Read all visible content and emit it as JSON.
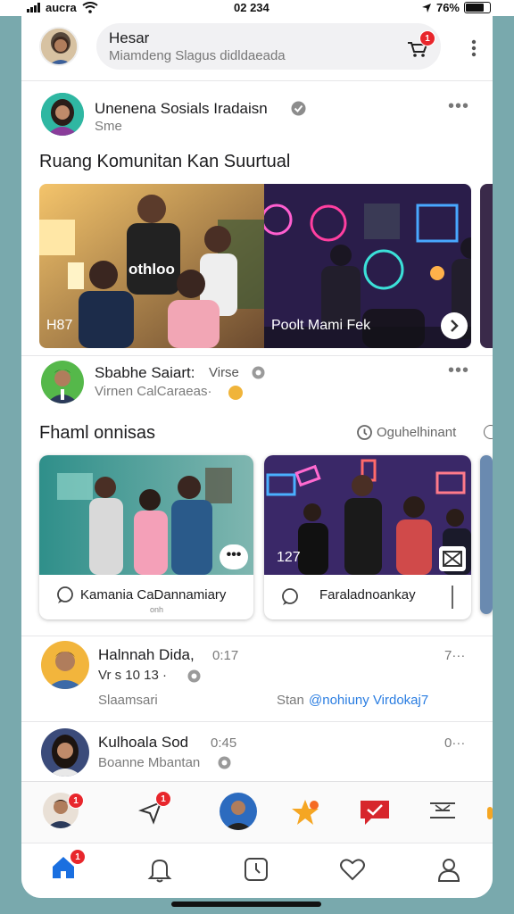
{
  "status_bar": {
    "carrier": "aucra",
    "time": "02 234",
    "battery": "76%"
  },
  "search": {
    "title": "Hesar",
    "placeholder": "Miamdeng Slagus didldaeada",
    "notification_count": "1"
  },
  "post1": {
    "name": "Unenena Sosials Iradaisn",
    "sub": "Sme",
    "title": "Ruang Komunitan Kan Suurtual",
    "left_overlay": "H87",
    "shirt_text": "othloo",
    "right_overlay": "Poolt Mami Fek"
  },
  "post2": {
    "name": "Sbabhe Saiart:",
    "name_suffix": "Virse",
    "sub": "Virnen CalCaraeas·"
  },
  "section2": {
    "title": "Fhaml onnisas",
    "link": "Oguhelhinant",
    "card1_label": "Kamania CaDannamiary",
    "card1_sub": "onh",
    "card2_label": "Faraladnoankay",
    "card2_count": "127"
  },
  "post3": {
    "name": "Halnnah Dida,",
    "time": "0:17",
    "meta_right": "7···",
    "line2": "Vr s 10 13 ·",
    "line3_left": "Slaamsari",
    "line3_mid": "Stan",
    "line3_link": "@nohiuny Virdokaj7"
  },
  "post4": {
    "name": "Kulhoala Sod",
    "time": "0:45",
    "meta_right": "0···",
    "sub": "Boanne Mbantan"
  },
  "action_bar": {
    "badge1": "1",
    "badge2": "1"
  },
  "tab_bar": {
    "home_badge": "1"
  }
}
